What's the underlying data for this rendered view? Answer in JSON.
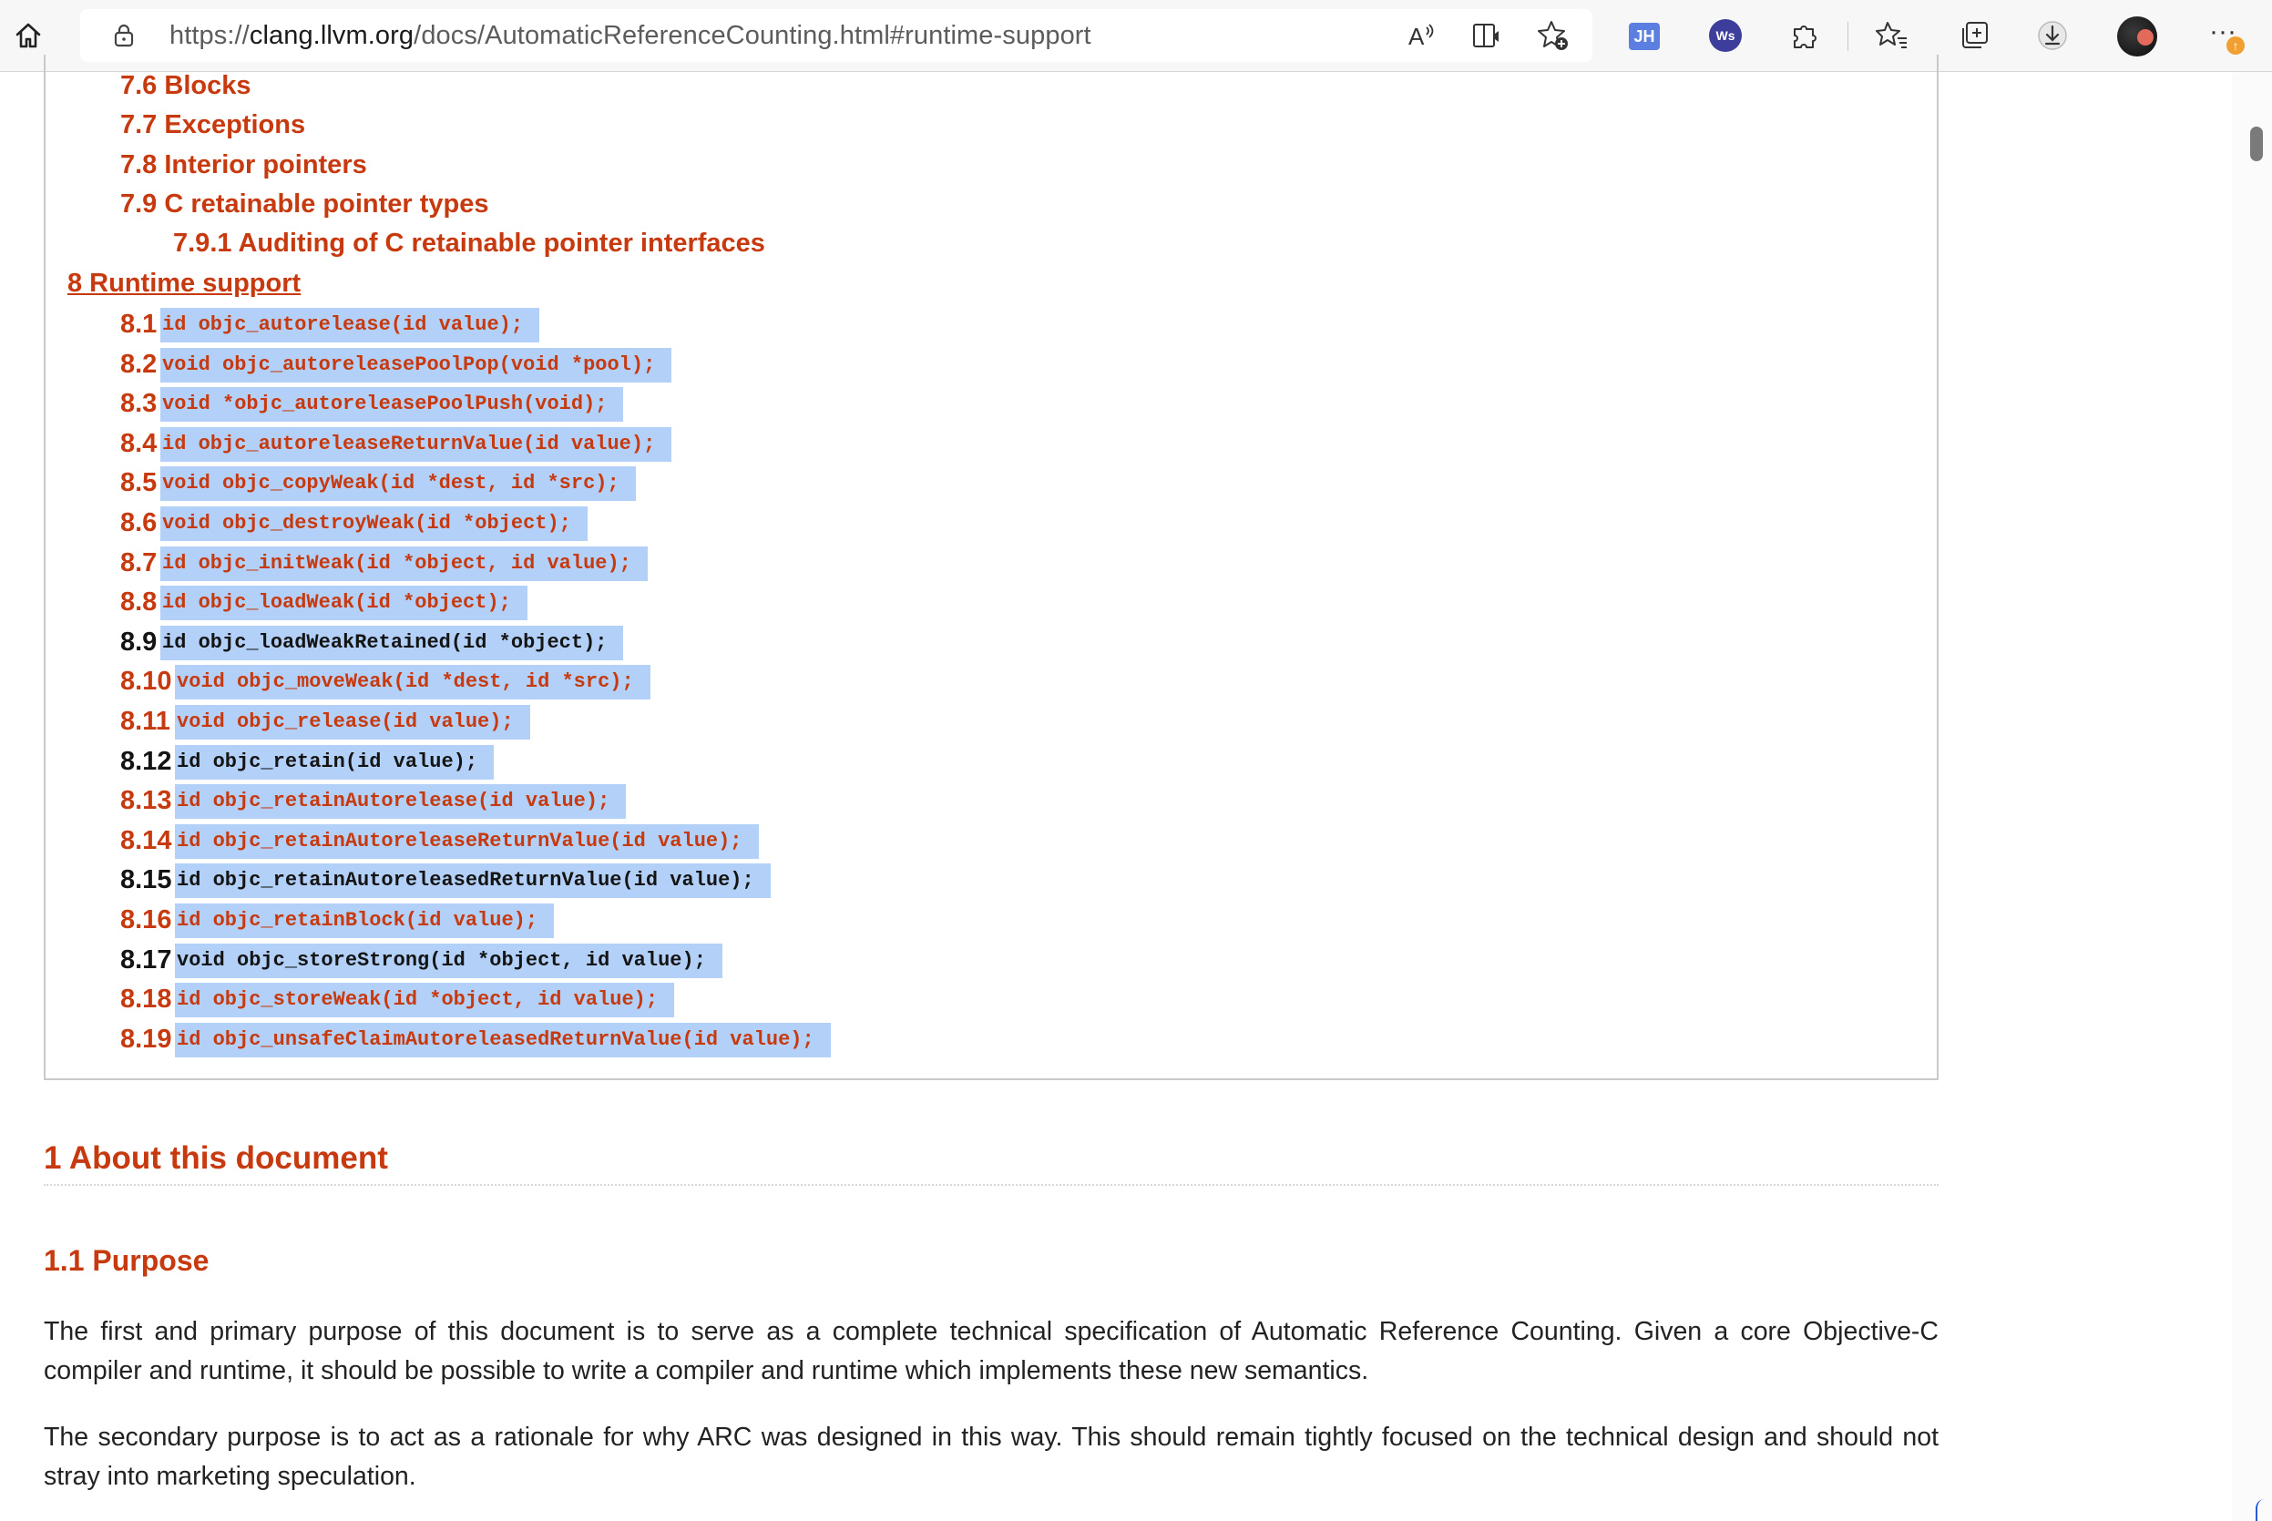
{
  "browser": {
    "url_prefix": "https://",
    "url_host": "clang.llvm.org",
    "url_path": "/docs/AutomaticReferenceCounting.html#runtime-support",
    "extension_jh_label": "JH",
    "extension_ws_label": "Ws",
    "update_badge": "↑",
    "icons": [
      "home-icon",
      "lock-icon",
      "read-aloud-icon",
      "immersive-reader-icon",
      "add-favorite-icon",
      "extensions-icon",
      "favorites-icon",
      "collections-icon",
      "downloads-icon",
      "profile-avatar",
      "more-icon"
    ]
  },
  "toc": {
    "section7_items": [
      "7.6 Blocks",
      "7.7 Exceptions",
      "7.8 Interior pointers",
      "7.9 C retainable pointer types"
    ],
    "section7_sub": "7.9.1 Auditing of C retainable pointer interfaces",
    "section8_title": "8 Runtime support",
    "functions": [
      {
        "num": "8.1",
        "code": "id objc_autorelease(id value);",
        "visited": false
      },
      {
        "num": "8.2",
        "code": "void objc_autoreleasePoolPop(void *pool);",
        "visited": false
      },
      {
        "num": "8.3",
        "code": "void *objc_autoreleasePoolPush(void);",
        "visited": false
      },
      {
        "num": "8.4",
        "code": "id objc_autoreleaseReturnValue(id value);",
        "visited": false
      },
      {
        "num": "8.5",
        "code": "void objc_copyWeak(id *dest, id *src);",
        "visited": false
      },
      {
        "num": "8.6",
        "code": "void objc_destroyWeak(id *object);",
        "visited": false
      },
      {
        "num": "8.7",
        "code": "id objc_initWeak(id *object, id value);",
        "visited": false
      },
      {
        "num": "8.8",
        "code": "id objc_loadWeak(id *object);",
        "visited": false
      },
      {
        "num": "8.9",
        "code": "id objc_loadWeakRetained(id *object);",
        "visited": true
      },
      {
        "num": "8.10",
        "code": "void objc_moveWeak(id *dest, id *src);",
        "visited": false
      },
      {
        "num": "8.11",
        "code": "void objc_release(id value);",
        "visited": false
      },
      {
        "num": "8.12",
        "code": "id objc_retain(id value);",
        "visited": true
      },
      {
        "num": "8.13",
        "code": "id objc_retainAutorelease(id value);",
        "visited": false
      },
      {
        "num": "8.14",
        "code": "id objc_retainAutoreleaseReturnValue(id value);",
        "visited": false
      },
      {
        "num": "8.15",
        "code": "id objc_retainAutoreleasedReturnValue(id value);",
        "visited": true
      },
      {
        "num": "8.16",
        "code": "id objc_retainBlock(id value);",
        "visited": false
      },
      {
        "num": "8.17",
        "code": "void objc_storeStrong(id *object, id value);",
        "visited": true
      },
      {
        "num": "8.18",
        "code": "id objc_storeWeak(id *object, id value);",
        "visited": false
      },
      {
        "num": "8.19",
        "code": "id objc_unsafeClaimAutoreleasedReturnValue(id value);",
        "visited": false
      }
    ]
  },
  "content": {
    "h1": "1 About this document",
    "h2": "1.1 Purpose",
    "para1_line1": "The first and primary purpose of this document is to serve as a complete technical specification of Automatic Reference Counting. Given a core Objective-C",
    "para1_line2": "compiler and runtime, it should be possible to write a compiler and runtime which implements these new semantics.",
    "para2_line1": "The secondary purpose is to act as a rationale for why ARC was designed in this way. This should remain tightly focused on the technical design and should not",
    "para2_line2": "stray into marketing speculation."
  },
  "colors": {
    "link": "#c7390e",
    "visited_text": "#141414",
    "selection": "#b3d1f8"
  }
}
